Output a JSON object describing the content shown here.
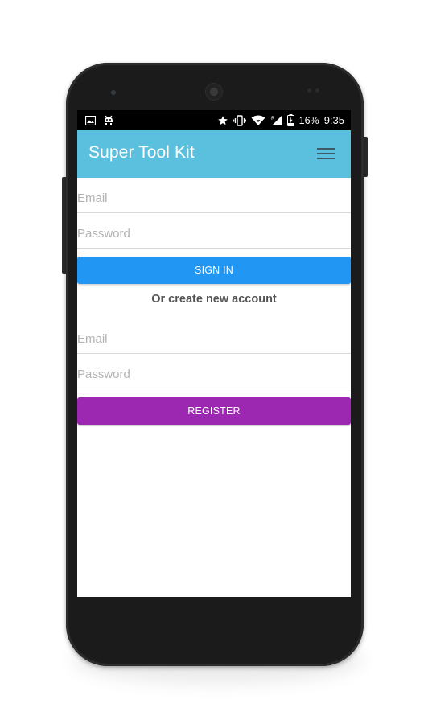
{
  "status_bar": {
    "battery_percent": "16%",
    "time": "9:35",
    "icons_left": [
      "image-icon",
      "android-debug-icon"
    ],
    "icons_right": [
      "star-icon",
      "vibrate-icon",
      "wifi-icon",
      "signal-roaming-icon",
      "battery-charging-icon"
    ]
  },
  "app_bar": {
    "title": "Super Tool Kit",
    "menu_icon": "hamburger-menu-icon",
    "color": "#5bc0de"
  },
  "login": {
    "email_placeholder": "Email",
    "email_value": "",
    "password_placeholder": "Password",
    "password_value": "",
    "button_label": "SIGN IN",
    "button_color": "#2196f3"
  },
  "divider_text": "Or create new account",
  "register": {
    "email_placeholder": "Email",
    "email_value": "",
    "password_placeholder": "Password",
    "password_value": "",
    "button_label": "REGISTER",
    "button_color": "#9c27b0"
  }
}
